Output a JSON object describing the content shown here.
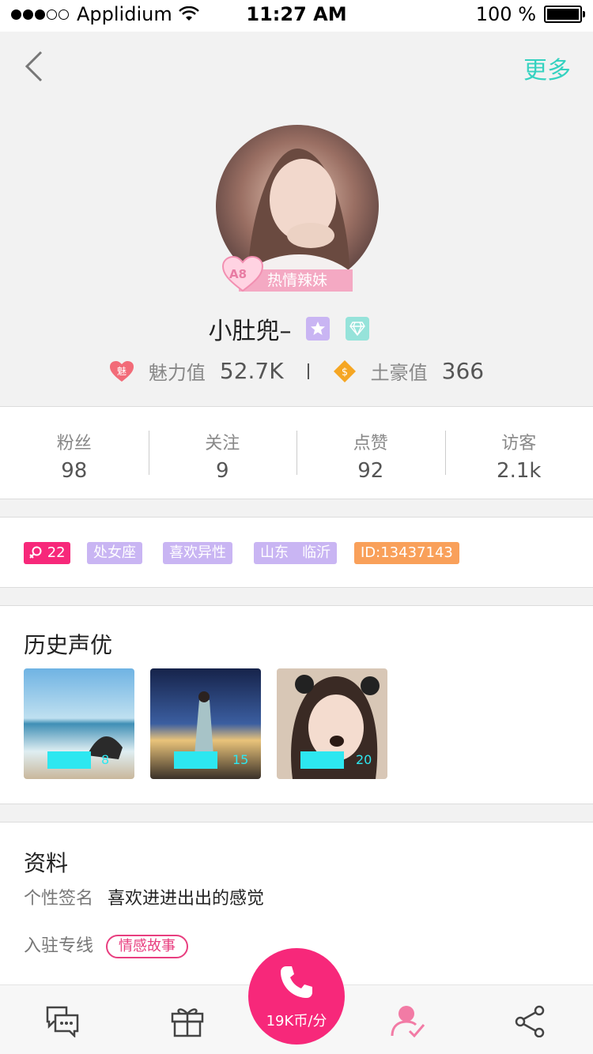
{
  "status_bar": {
    "carrier": "Applidium",
    "time": "11:27 AM",
    "battery": "100 %"
  },
  "header": {
    "more_label": "更多"
  },
  "profile": {
    "badge_level": "A8",
    "badge_title": "热情辣妹",
    "name": "小肚兜–",
    "charm_icon_text": "魅",
    "charm_label": "魅力值",
    "charm_value": "52.7K",
    "wealth_label": "土豪值",
    "wealth_value": "366"
  },
  "counts": [
    {
      "label": "粉丝",
      "value": "98"
    },
    {
      "label": "关注",
      "value": "9"
    },
    {
      "label": "点赞",
      "value": "92"
    },
    {
      "label": "访客",
      "value": "2.1k"
    }
  ],
  "tags": {
    "gender_age": "22",
    "items": [
      "处女座",
      "喜欢异性",
      "山东   临沂",
      "ID:13437143"
    ]
  },
  "history": {
    "title": "历史声优",
    "items": [
      {
        "count": "8"
      },
      {
        "count": "15"
      },
      {
        "count": "20"
      }
    ]
  },
  "details": {
    "title": "资料",
    "signature_label": "个性签名",
    "signature_value": "喜欢进进出出的感觉",
    "line_label": "入驻专线",
    "line_tag": "情感故事"
  },
  "bottom_bar": {
    "call_price": "19K币/分"
  },
  "colors": {
    "accent_teal": "#35d2c0",
    "accent_pink": "#f7287a",
    "tag_purple": "#c9b5f3",
    "tag_orange": "#f9a05a"
  }
}
